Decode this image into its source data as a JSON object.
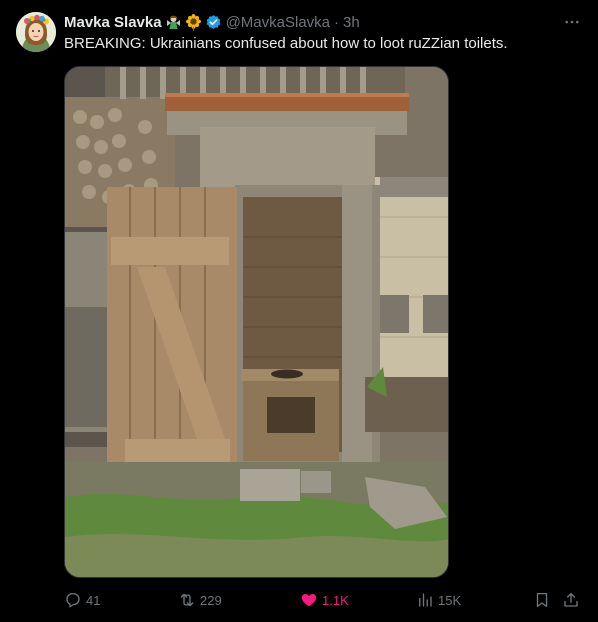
{
  "tweet": {
    "author": {
      "display_name": "Mavka Slavka",
      "emojis": [
        "woman-fairy-emoji",
        "sunflower-emoji"
      ],
      "verified": true,
      "handle": "@MavkaSlavka",
      "separator": "·",
      "time": "3h"
    },
    "text": "BREAKING: Ukrainians confused about how to loot ruZZian toilets.",
    "media": {
      "kind": "photo",
      "subject": "weathered wooden outhouse with open door"
    },
    "actions": {
      "replies": "41",
      "reposts": "229",
      "likes": "1.1K",
      "views": "15K"
    }
  },
  "colors": {
    "background": "#000000",
    "text": "#e7e9ea",
    "muted": "#71767b",
    "verified": "#1d9bf0",
    "like": "#f91880"
  },
  "icons": [
    "more-icon",
    "reply-icon",
    "repost-icon",
    "like-icon",
    "views-icon",
    "bookmark-icon",
    "share-icon"
  ]
}
